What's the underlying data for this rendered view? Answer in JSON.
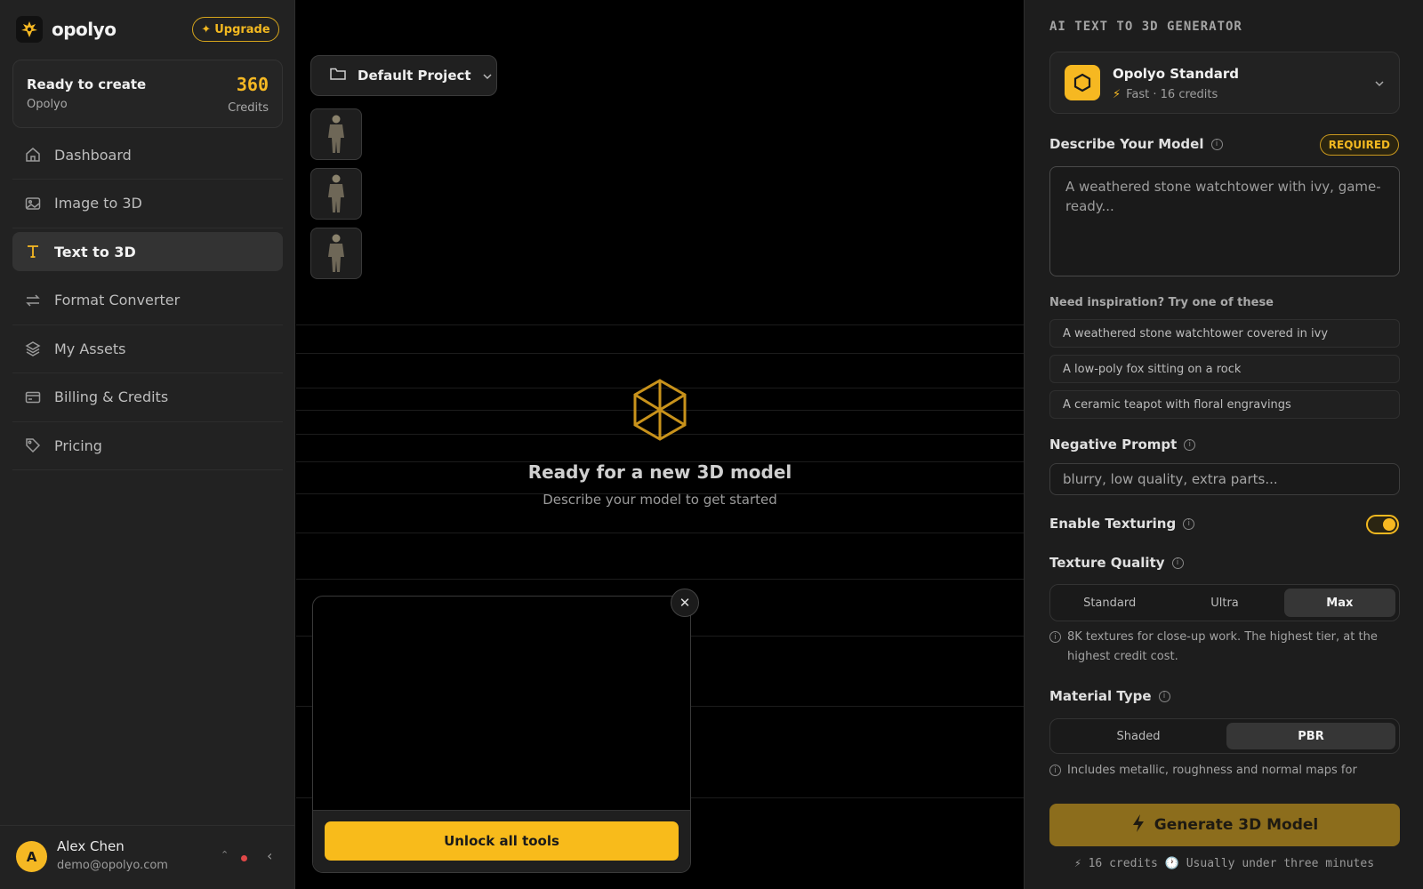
{
  "brand": {
    "name": "opolyo",
    "upgrade_label": "Upgrade",
    "accent": "#f5b823"
  },
  "credits_card": {
    "title": "Ready to create",
    "subtitle": "Opolyo",
    "count": "360",
    "count_label": "Credits"
  },
  "nav": {
    "items": [
      {
        "label": "Dashboard",
        "icon": "home-icon"
      },
      {
        "label": "Image to 3D",
        "icon": "image-icon"
      },
      {
        "label": "Text to 3D",
        "icon": "text-icon",
        "active": true
      },
      {
        "label": "Format Converter",
        "icon": "swap-icon"
      },
      {
        "label": "My Assets",
        "icon": "layers-icon"
      },
      {
        "label": "Billing & Credits",
        "icon": "card-icon"
      },
      {
        "label": "Pricing",
        "icon": "tag-icon"
      }
    ]
  },
  "user": {
    "initial": "A",
    "name": "Alex Chen",
    "email": "demo@opolyo.com"
  },
  "canvas": {
    "project_label": "Default Project",
    "empty_title": "Ready for a new 3D model",
    "empty_subtitle": "Describe your model to get started",
    "promo_button": "Unlock all tools"
  },
  "panel": {
    "heading": "AI TEXT TO 3D GENERATOR",
    "model": {
      "name": "Opolyo Standard",
      "meta": "Fast · 16 credits"
    },
    "describe_label": "Describe Your Model",
    "required_badge": "REQUIRED",
    "prompt_placeholder": "A weathered stone watchtower with ivy, game-ready...",
    "inspiration_label": "Need inspiration? Try one of these",
    "suggestions": [
      "A weathered stone watchtower covered in ivy",
      "A low-poly fox sitting on a rock",
      "A ceramic teapot with floral engravings"
    ],
    "negative_label": "Negative Prompt",
    "negative_placeholder": "blurry, low quality, extra parts...",
    "texturing_label": "Enable Texturing",
    "texturing_enabled": true,
    "texture_quality_label": "Texture Quality",
    "texture_options": [
      "Standard",
      "Ultra",
      "Max"
    ],
    "texture_selected": "Max",
    "texture_hint": "8K textures for close-up work. The highest tier, at the highest credit cost.",
    "material_label": "Material Type",
    "material_options": [
      "Shaded",
      "PBR"
    ],
    "material_selected": "PBR",
    "material_hint": "Includes metallic, roughness and normal maps for",
    "generate_label": "Generate 3D Model",
    "generate_meta": "⚡ 16 credits  🕐 Usually under three minutes"
  }
}
